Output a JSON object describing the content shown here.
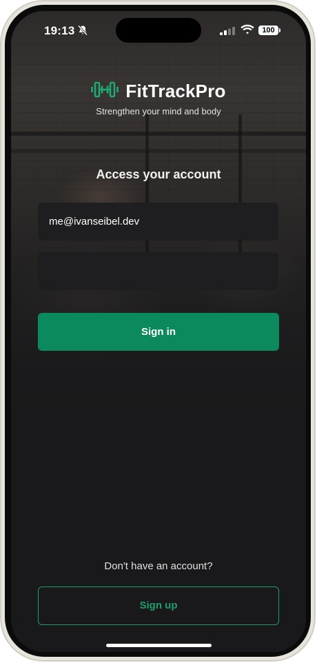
{
  "status_bar": {
    "time": "19:13",
    "battery": "100",
    "icons": [
      "bell-slash-icon",
      "cellular-signal-icon",
      "wifi-icon",
      "battery-icon"
    ]
  },
  "brand": {
    "name": "FitTrackPro",
    "tagline": "Strengthen your mind and body",
    "logo_icon": "dumbbell-icon",
    "accent_color": "#1fa774"
  },
  "login": {
    "heading": "Access your account",
    "email_value": "me@ivanseibel.dev",
    "password_value": "",
    "sign_in_label": "Sign in",
    "sign_in_color": "#0b8a5e"
  },
  "signup": {
    "prompt": "Don't have an account?",
    "button_label": "Sign up"
  }
}
